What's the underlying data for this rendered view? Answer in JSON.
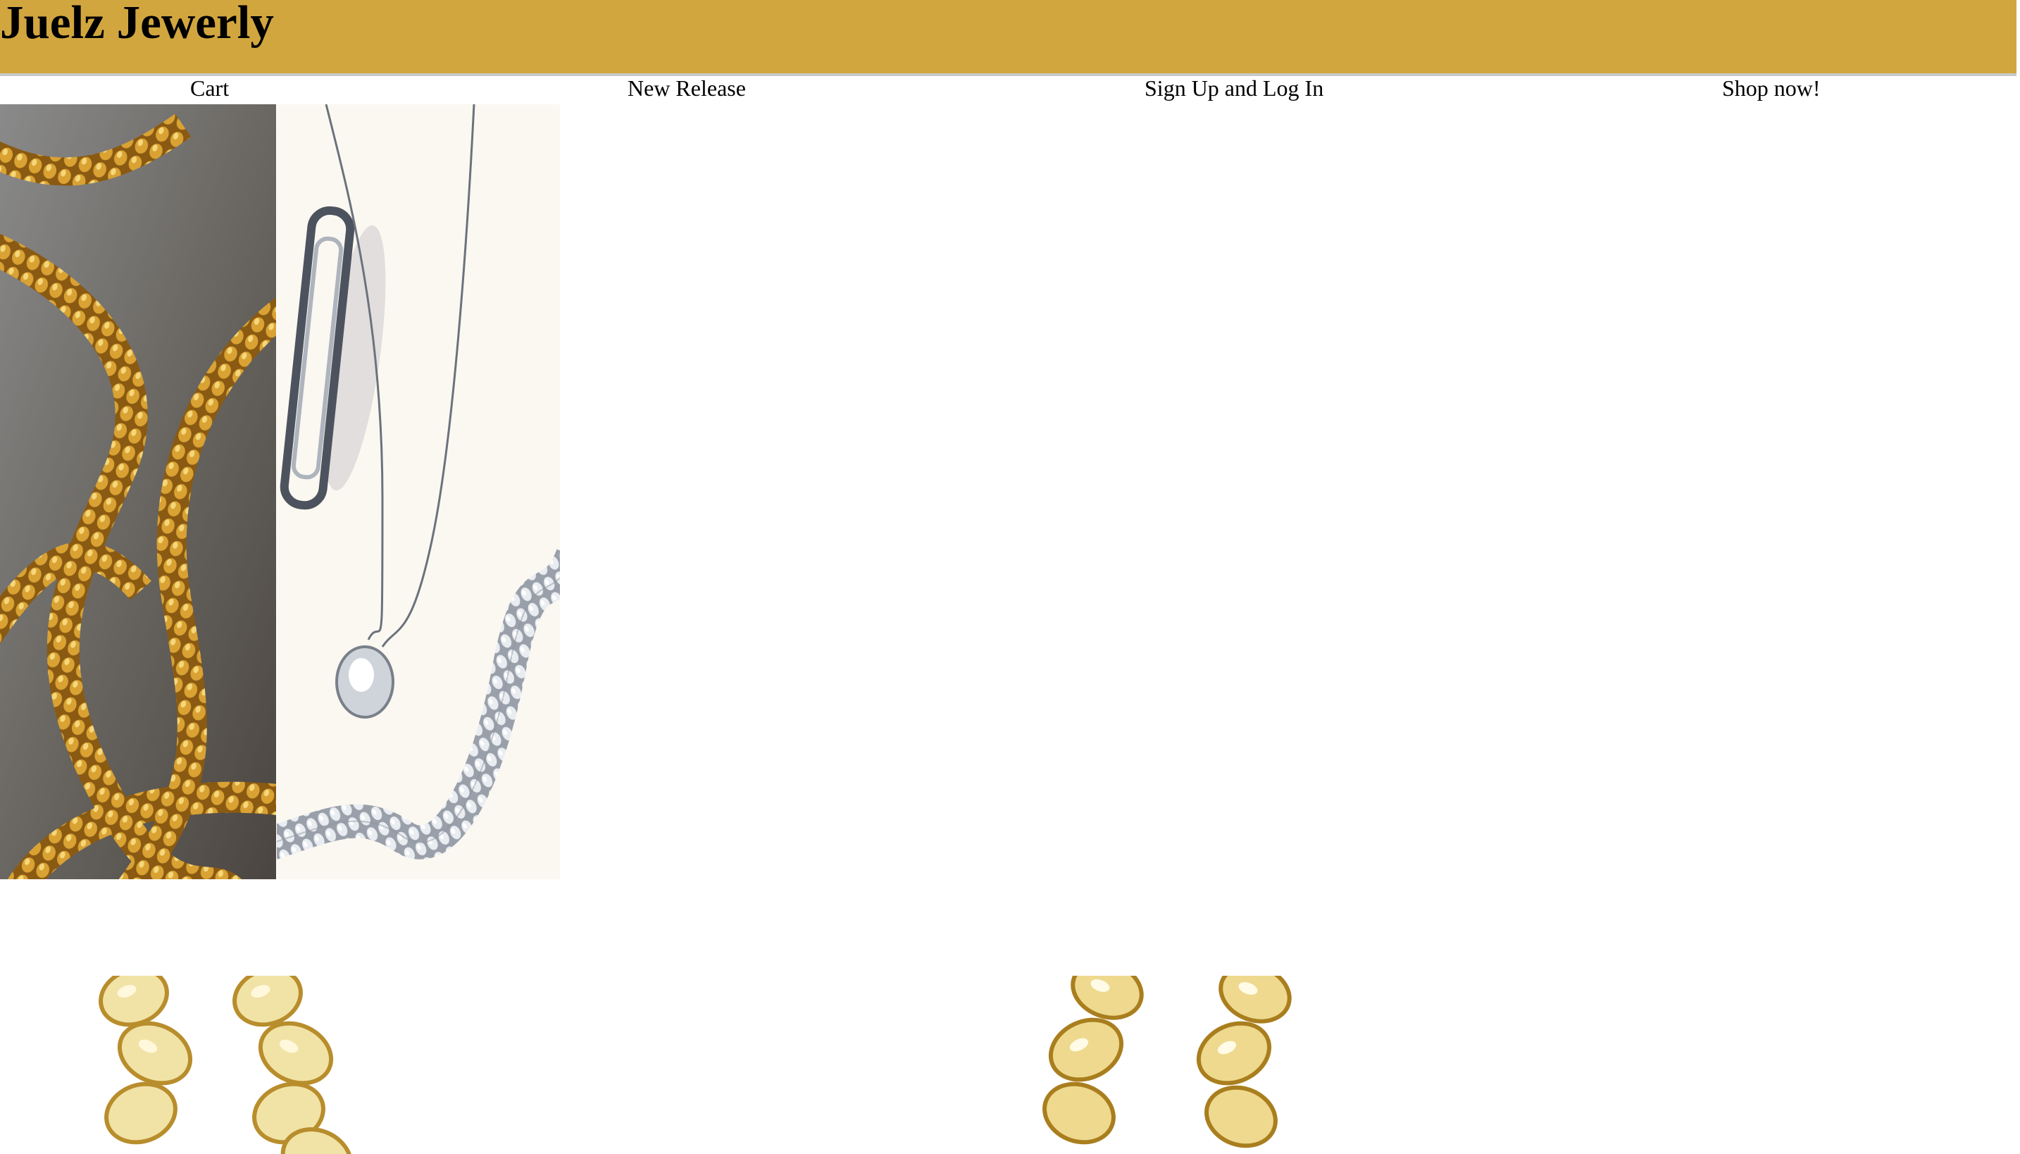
{
  "header": {
    "title": "Juelz Jewerly",
    "background_color": "#d2a63f"
  },
  "nav": {
    "items": [
      "Cart",
      "New Release",
      "Sign Up and Log In",
      "Shop now!"
    ]
  },
  "hero_images": [
    {
      "subject": "gold rope chain necklace on grey background"
    },
    {
      "subject": "silver diamond pendant necklace, bracelet and ring"
    }
  ],
  "products": [
    {
      "subject": "gold cuban link chain"
    },
    {
      "subject": "gold cuban link chain"
    }
  ]
}
